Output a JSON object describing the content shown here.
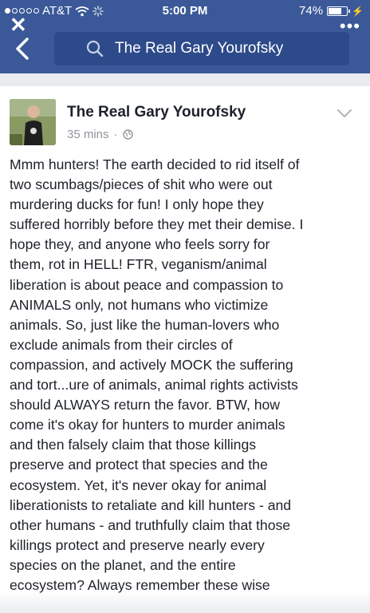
{
  "status_bar": {
    "carrier": "AT&T",
    "time": "5:00 PM",
    "battery": "74%",
    "battery_level": 0.74
  },
  "header": {
    "search_text": "The Real Gary Yourofsky"
  },
  "post": {
    "author": "The Real Gary Yourofsky",
    "time": "35 mins",
    "separator": "·",
    "lines": [
      "Mmm hunters! The earth decided to rid itself of",
      "two scumbags/pieces of shit who were out",
      "murdering ducks for fun! I only hope they",
      "suffered horribly before they met their demise. I",
      "hope they, and anyone who feels sorry for",
      "them, rot in HELL! FTR, veganism/animal",
      "liberation is about peace and compassion to",
      "ANIMALS only, not humans who victimize",
      "animals. So, just like the human-lovers who",
      "exclude animals from their circles of",
      "compassion, and actively MOCK the suffering",
      "and tort...ure of animals, animal rights activists",
      "should ALWAYS return the favor. BTW, how",
      "come it's okay for hunters to murder animals",
      "and then falsely claim that those killings",
      "preserve and protect that species and the",
      "ecosystem. Yet, it's never okay for animal",
      "liberationists to retaliate and kill hunters - and",
      "other humans - and truthfully claim that those",
      "killings protect and preserve nearly every",
      "species on the planet, and the entire",
      "ecosystem? Always remember these wise"
    ]
  },
  "icons": {
    "close": "close-icon",
    "more": "more-icon",
    "back": "back-arrow-icon",
    "search": "search-icon",
    "globe": "globe-icon",
    "chevron": "chevron-down-icon"
  },
  "colors": {
    "brand": "#3b5998",
    "search_bg": "#2d4a8a",
    "text": "#1d2129",
    "meta": "#90949c"
  }
}
